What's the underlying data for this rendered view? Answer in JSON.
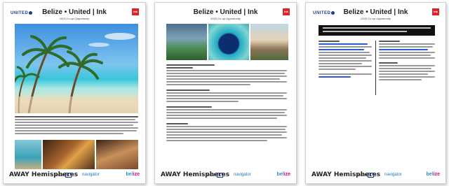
{
  "pages": [
    {
      "brand": "UNITED",
      "title": "Belize • United | Ink",
      "subtitle": "2025 Co-op Opportunity",
      "badge": "ink",
      "footer": {
        "brand": "AWAY Hemispheres",
        "reach": "reach",
        "reach_tv": "TV",
        "navigator": "navigator",
        "beli_a": "bel",
        "beli_b": "ize"
      }
    },
    {
      "brand": "",
      "title": "Belize • United | Ink",
      "subtitle": "2025 Co-op Opportunity",
      "badge": "ink",
      "footer": {
        "brand": "AWAY Hemispheres",
        "reach": "reach",
        "reach_tv": "TV",
        "navigator": "navigator",
        "beli_a": "bel",
        "beli_b": "ize"
      }
    },
    {
      "brand": "UNITED",
      "title": "Belize • United | Ink",
      "subtitle": "2025 Co-op Opportunity",
      "badge": "ink",
      "footer": {
        "brand": "AWAY Hemispheres",
        "reach": "reach",
        "reach_tv": "TV",
        "navigator": "navigator",
        "beli_a": "bel",
        "beli_b": "ize"
      }
    }
  ],
  "colors": {
    "brand_blue": "#1b3d8f",
    "badge_red": "#d8262c",
    "navigator_blue": "#1b73b8",
    "belize_pink": "#e2007a"
  }
}
